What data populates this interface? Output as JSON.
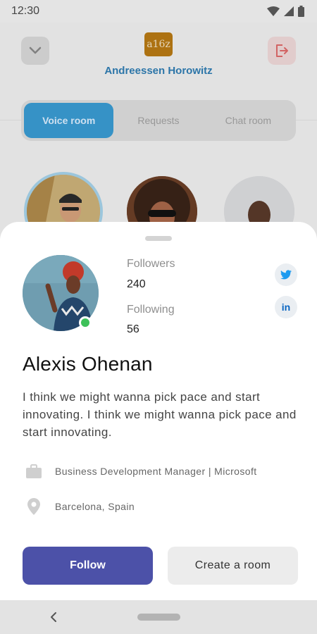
{
  "status_bar": {
    "time": "12:30"
  },
  "header": {
    "org_logo_text": "a16z",
    "org_name": "Andreessen Horowitz"
  },
  "tabs": [
    {
      "label": "Voice room",
      "active": true
    },
    {
      "label": "Requests",
      "active": false
    },
    {
      "label": "Chat room",
      "active": false
    }
  ],
  "profile": {
    "followers_label": "Followers",
    "followers_count": "240",
    "following_label": "Following",
    "following_count": "56",
    "name": "Alexis Ohenan",
    "bio": "I think we might wanna pick pace and start innovating. I think we might wanna pick pace and start innovating.",
    "job": "Business Development Manager | Microsoft",
    "location": "Barcelona, Spain",
    "linkedin_label": "in",
    "online": true
  },
  "actions": {
    "follow_label": "Follow",
    "create_room_label": "Create a room"
  },
  "colors": {
    "accent_blue": "#3a9cd3",
    "org_name": "#2f7db3",
    "follow_button": "#4c51a8",
    "online": "#3ec15a",
    "logo_bg": "#b87a14",
    "twitter": "#1d9bf0",
    "linkedin": "#0a66c2"
  },
  "icons": {
    "collapse": "chevron-down-icon",
    "exit": "logout-icon",
    "twitter": "twitter-icon",
    "linkedin": "linkedin-icon",
    "job": "briefcase-icon",
    "location": "location-pin-icon",
    "back": "back-chevron-icon"
  }
}
